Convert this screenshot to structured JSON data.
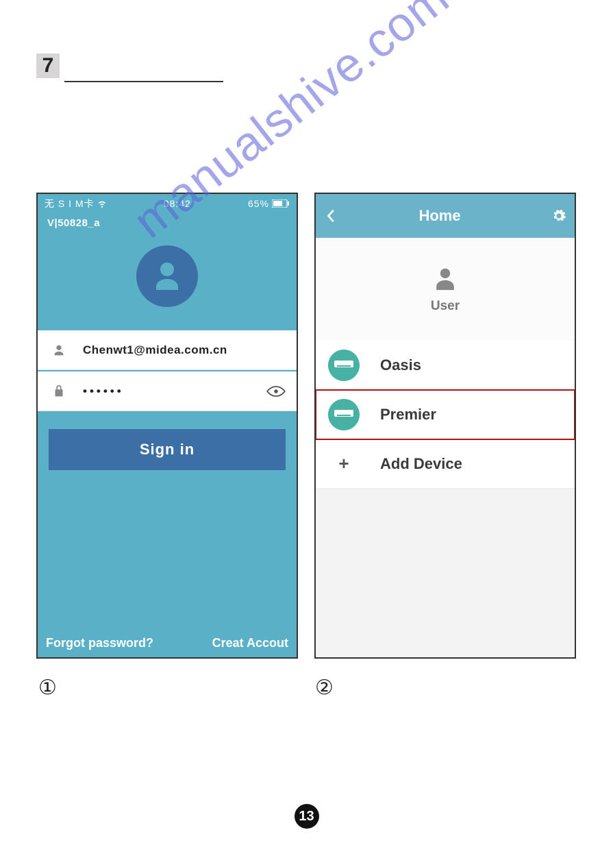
{
  "section_number": "7",
  "watermark": "manualshive.com",
  "page_number": "13",
  "steps": {
    "one": "①",
    "two": "②"
  },
  "phone1": {
    "status": {
      "carrier": "无 S I M卡",
      "time": "08:42",
      "battery_pct": "65%"
    },
    "version": "V|50828_a",
    "email": "Chenwt1@midea.com.cn",
    "password_masked": "••••••",
    "signin": "Sign in",
    "forgot": "Forgot password?",
    "create": "Creat Accout"
  },
  "phone2": {
    "title": "Home",
    "user_label": "User",
    "items": [
      {
        "label": "Oasis",
        "type": "device",
        "highlight": false
      },
      {
        "label": "Premier",
        "type": "device",
        "highlight": true
      },
      {
        "label": "Add Device",
        "type": "add",
        "highlight": false
      }
    ]
  }
}
